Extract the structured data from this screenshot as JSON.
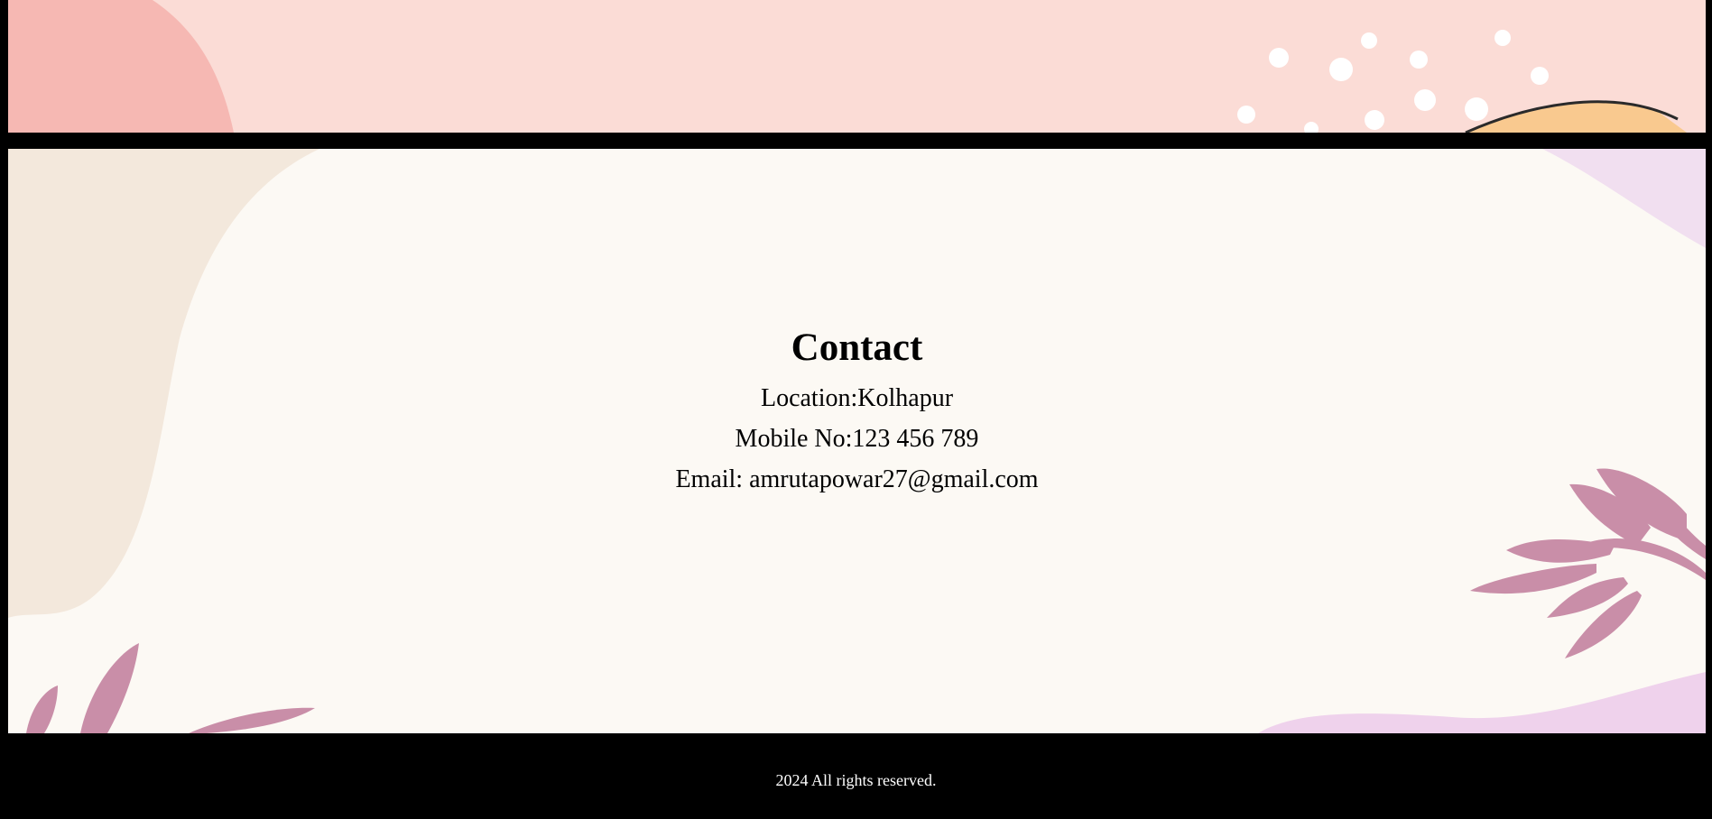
{
  "contact": {
    "title": "Contact",
    "location": "Location:Kolhapur",
    "mobile": "Mobile No:123 456 789",
    "email": "Email: amrutapowar27@gmail.com"
  },
  "footer": {
    "text": "2024 All rights reserved."
  },
  "colors": {
    "page_background": "#000000",
    "banner_background": "#fbdcd6",
    "contact_background": "#fcf9f4",
    "leaf_color": "#c98ea8",
    "text_color": "#000000",
    "footer_text_color": "#ffffff"
  }
}
